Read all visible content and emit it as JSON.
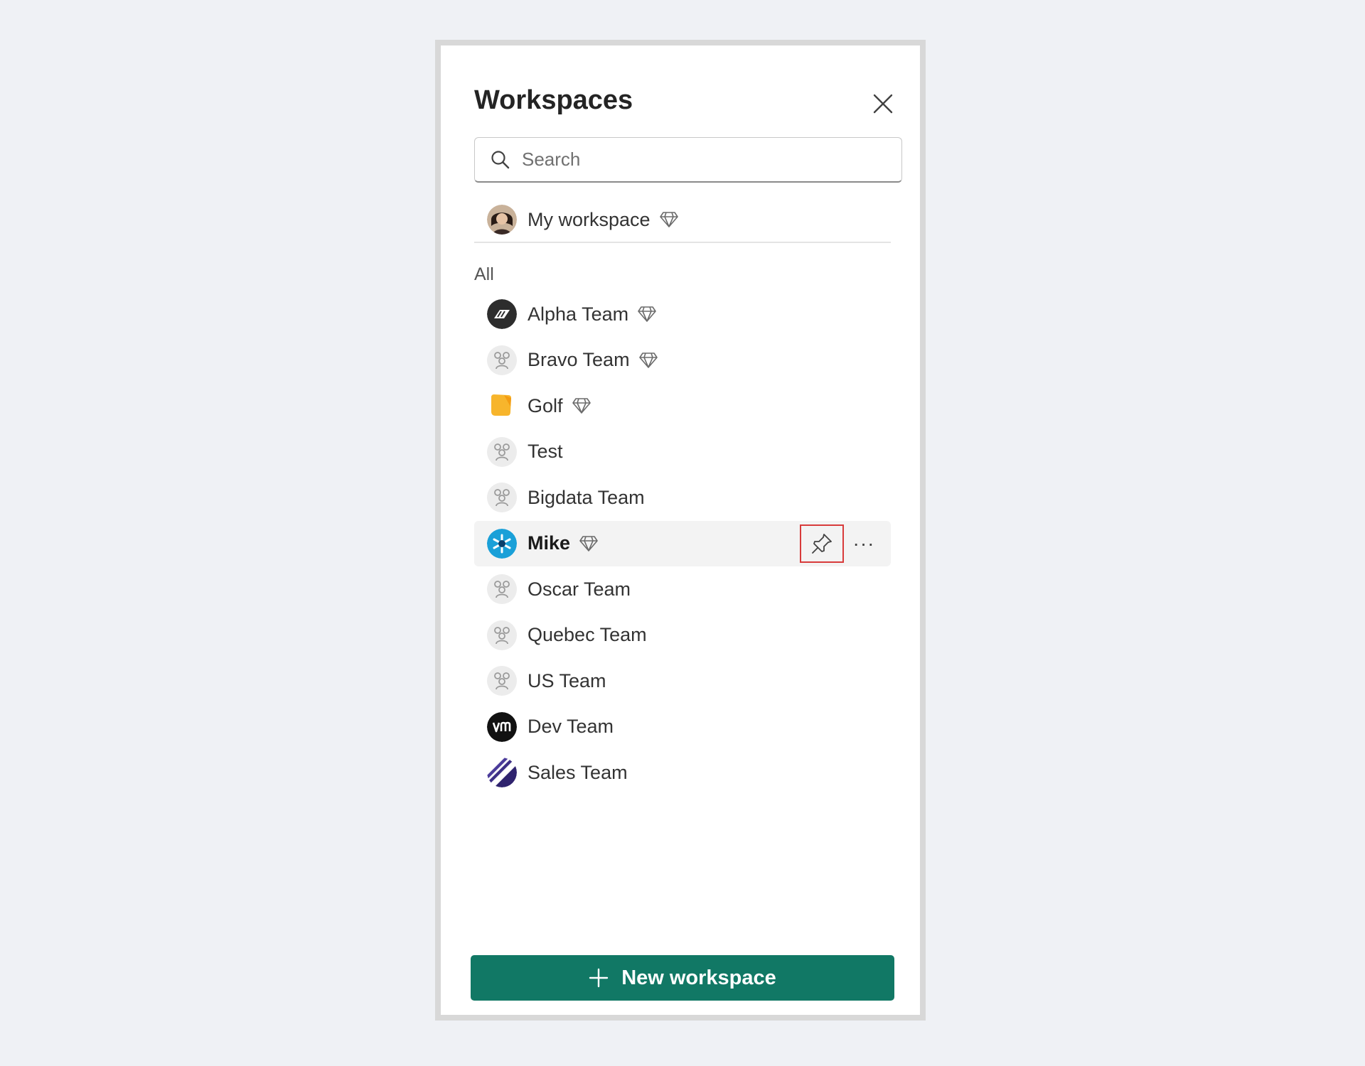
{
  "panel": {
    "title": "Workspaces"
  },
  "search": {
    "placeholder": "Search",
    "value": ""
  },
  "my_workspace": {
    "label": "My workspace",
    "icon": "user-photo-avatar",
    "premium": true
  },
  "list": {
    "section_label": "All",
    "items": [
      {
        "label": "Alpha Team",
        "icon": "alpha-logo-avatar",
        "premium": true
      },
      {
        "label": "Bravo Team",
        "icon": "group-icon",
        "premium": true
      },
      {
        "label": "Golf",
        "icon": "golf-logo-avatar",
        "premium": true
      },
      {
        "label": "Test",
        "icon": "group-icon",
        "premium": false
      },
      {
        "label": "Bigdata Team",
        "icon": "group-icon",
        "premium": false
      },
      {
        "label": "Mike",
        "icon": "mike-logo-avatar",
        "premium": true,
        "active": true
      },
      {
        "label": "Oscar Team",
        "icon": "group-icon",
        "premium": false
      },
      {
        "label": "Quebec Team",
        "icon": "group-icon",
        "premium": false
      },
      {
        "label": "US Team",
        "icon": "group-icon",
        "premium": false
      },
      {
        "label": "Dev Team",
        "icon": "dev-logo-avatar",
        "premium": false
      },
      {
        "label": "Sales Team",
        "icon": "sales-logo-avatar",
        "premium": false
      }
    ]
  },
  "row_actions": {
    "pin_icon": "pin-icon",
    "more_label": "···"
  },
  "footer": {
    "new_workspace_label": "New workspace"
  },
  "colors": {
    "primary": "#117865",
    "highlight_border": "#d83b3b",
    "active_row": "#f3f3f3"
  }
}
